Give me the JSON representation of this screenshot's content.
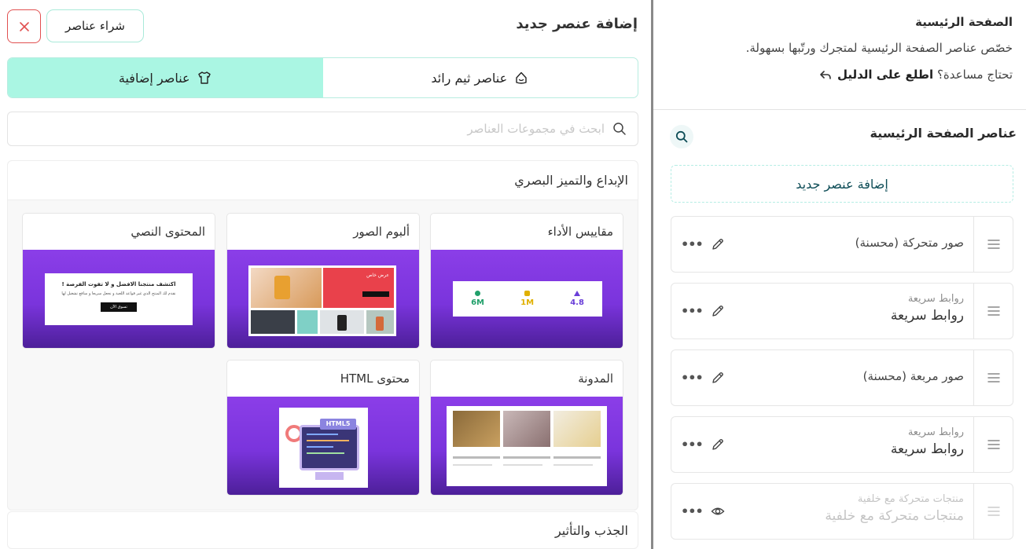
{
  "sidebar": {
    "title": "الصفحة الرئيسية",
    "description": "خصّص عناصر الصفحة الرئيسية لمتجرك ورتّبها بسهولة.",
    "help_question": "تحتاج مساعدة؟",
    "help_link": "اطلع على الدليل",
    "section_title": "عناصر الصفحة الرئيسية",
    "add_button": "إضافة عنصر جديد",
    "items": [
      {
        "sub": "",
        "label": "صور متحركة (محسنة)",
        "action_icon": "edit-icon"
      },
      {
        "sub": "روابط سريعة",
        "label": "روابط سريعة",
        "action_icon": "edit-icon"
      },
      {
        "sub": "",
        "label": "صور مربعة (محسنة)",
        "action_icon": "edit-icon"
      },
      {
        "sub": "روابط سريعة",
        "label": "روابط سريعة",
        "action_icon": "edit-icon"
      },
      {
        "sub": "منتجات متحركة مع خلفية",
        "label": "منتجات متحركة مع خلفية",
        "action_icon": "eye-icon"
      }
    ]
  },
  "panel": {
    "title": "إضافة عنصر جديد",
    "buy_button": "شراء عناصر",
    "tabs": [
      {
        "label": "عناصر ثيم رائد",
        "icon": "theme-icon",
        "active": false
      },
      {
        "label": "عناصر إضافية",
        "icon": "shirt-icon",
        "active": true
      }
    ],
    "search_placeholder": "ابحث في مجموعات العناصر",
    "groups": [
      {
        "title": "الإبداع والتميز البصري",
        "cards": [
          {
            "title": "مقاييس الأداء"
          },
          {
            "title": "ألبوم الصور"
          },
          {
            "title": "المحتوى النصي"
          },
          {
            "title": "المدونة"
          },
          {
            "title": "محتوى HTML"
          }
        ]
      },
      {
        "title": "الجذب والتأثير"
      }
    ]
  },
  "previews": {
    "metrics": [
      {
        "value": "6M",
        "color": "#22a06b"
      },
      {
        "value": "1M",
        "color": "#e0b000"
      },
      {
        "value": "4.8",
        "color": "#6a3fd8"
      }
    ],
    "text_content": {
      "heading": "اكتشف منتجنا الافضل و لا تفوت الفرصة !",
      "body": "نقدم لك المنتج الذي غير قواعد اللعبة و نجعل سريعا و سافع تشغيل لها",
      "button": "تسوق الآن"
    },
    "html_badge": "HTML5",
    "gallery_banner": "عرض خاص"
  },
  "colors": {
    "accent": "#aaf6e3",
    "accent_border": "#b8ece0",
    "close_red": "#e15050",
    "card_gradient_top": "#8b3ee8",
    "card_gradient_bottom": "#4c1f98"
  }
}
